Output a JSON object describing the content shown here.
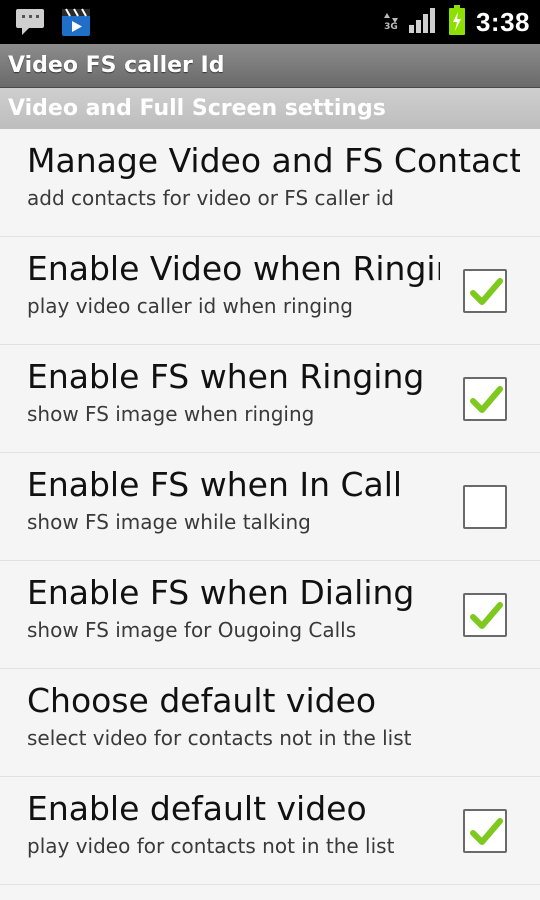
{
  "status_bar": {
    "time": "3:38",
    "network": "3G",
    "icons": [
      "message-icon",
      "video-app-icon",
      "signal-icon",
      "battery-charging-icon"
    ]
  },
  "app": {
    "title": "Video FS caller Id"
  },
  "section": {
    "header": "Video and Full Screen settings"
  },
  "preferences": [
    {
      "title": "Manage Video and FS Contacts",
      "summary": "add contacts for video or FS caller id",
      "has_checkbox": false
    },
    {
      "title": "Enable Video when Ringing",
      "summary": "play video caller id when ringing",
      "has_checkbox": true,
      "checked": true
    },
    {
      "title": "Enable FS when Ringing",
      "summary": "show FS image when ringing",
      "has_checkbox": true,
      "checked": true
    },
    {
      "title": "Enable FS when In Call",
      "summary": "show FS image while talking",
      "has_checkbox": true,
      "checked": false
    },
    {
      "title": "Enable FS when Dialing",
      "summary": "show FS image for Ougoing Calls",
      "has_checkbox": true,
      "checked": true
    },
    {
      "title": "Choose default video",
      "summary": "select video for contacts not in the list",
      "has_checkbox": false
    },
    {
      "title": "Enable default video",
      "summary": "play video for contacts not in the list",
      "has_checkbox": true,
      "checked": true
    }
  ],
  "colors": {
    "check_green": "#7dc91e",
    "status_bg": "#000000",
    "battery_green": "#8ee000"
  }
}
